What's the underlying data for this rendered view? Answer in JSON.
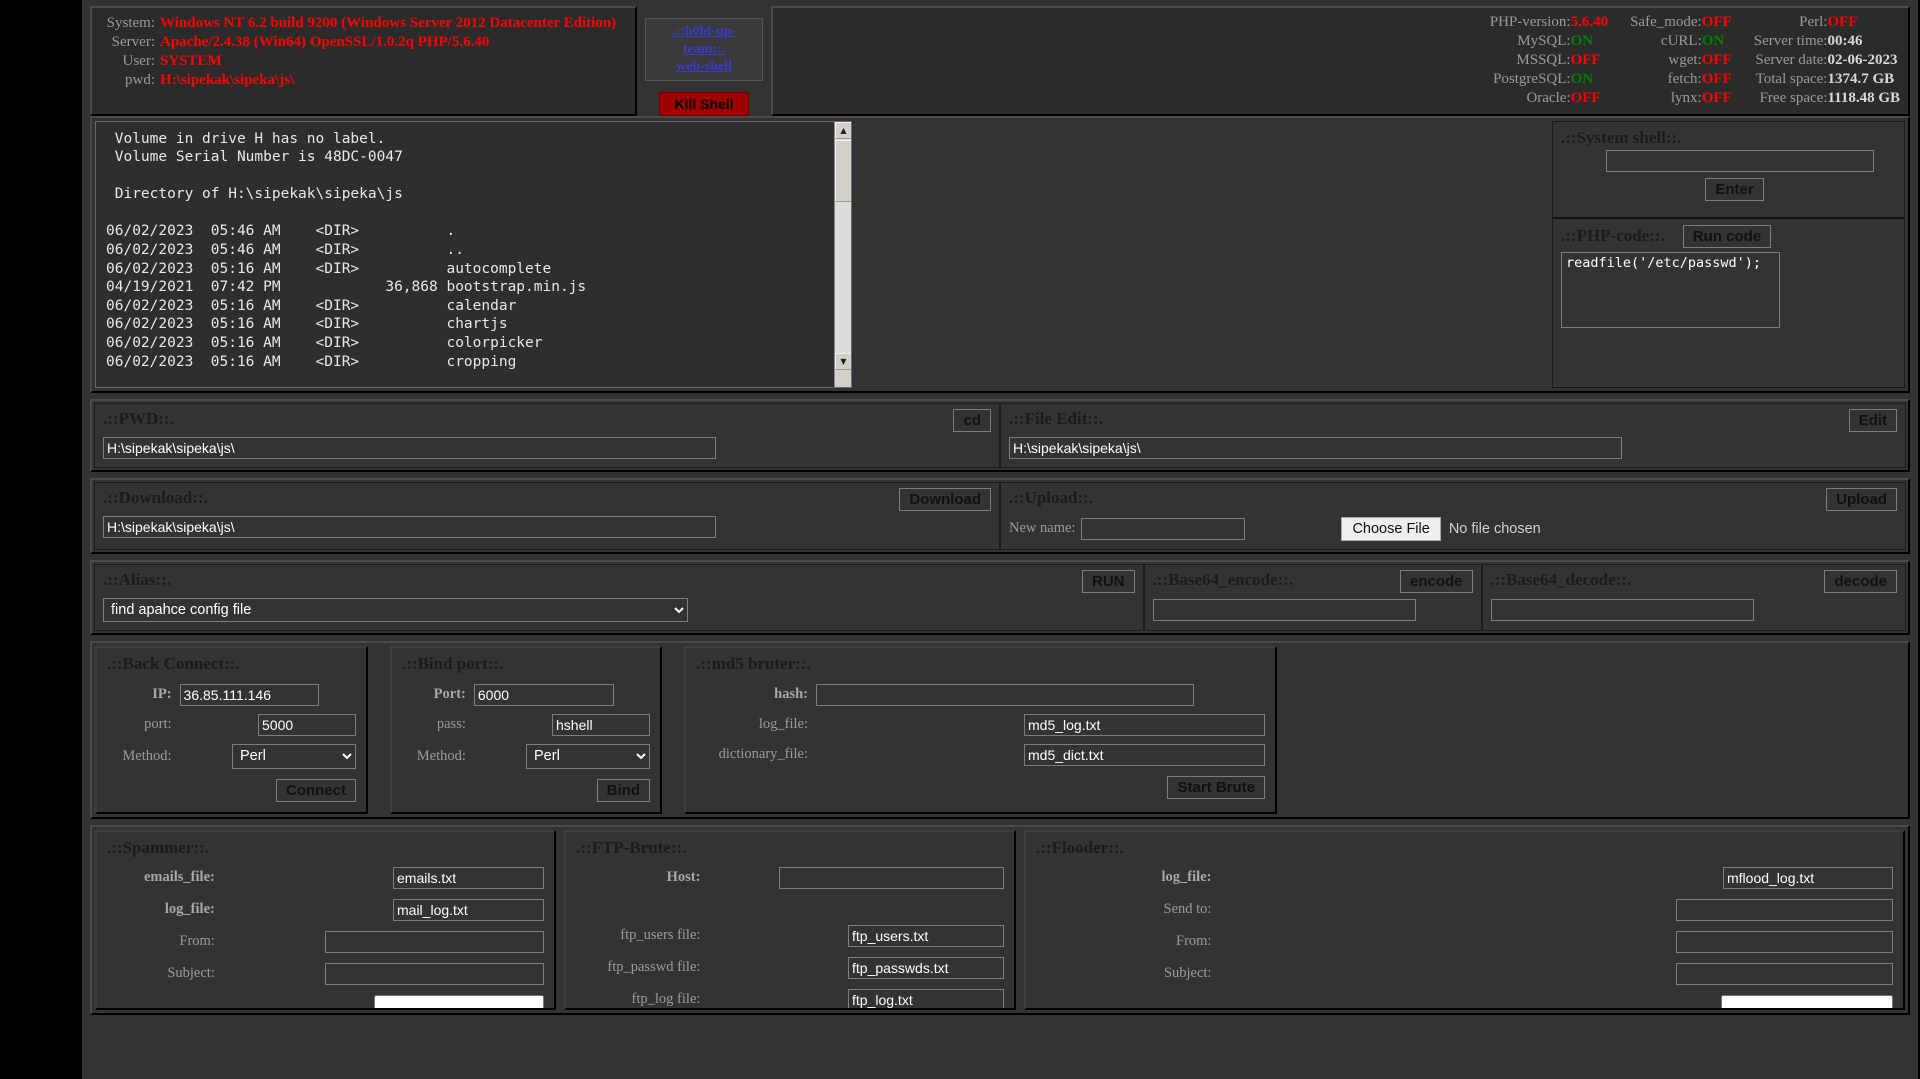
{
  "header": {
    "system_rows": [
      {
        "key": "System:",
        "value": "Windows NT 6.2 build 9200 (Windows Server 2012 Datacenter Edition)"
      },
      {
        "key": "Server:",
        "value": "Apache/2.4.38 (Win64) OpenSSL/1.0.2q PHP/5.6.40"
      },
      {
        "key": "User:",
        "value": "SYSTEM"
      },
      {
        "key": "pwd:",
        "value": "H:\\sipekak\\sipeka\\js\\"
      }
    ],
    "team_line1": ".::h0ld-up-team::.",
    "team_line2": "web-shell",
    "kill_shell": "Kill Shell",
    "info_col1": [
      {
        "key": "PHP-version:",
        "value": "5.6.40",
        "state": "red"
      },
      {
        "key": "MySQL:",
        "value": "ON",
        "state": "on"
      },
      {
        "key": "MSSQL:",
        "value": "OFF",
        "state": "off"
      },
      {
        "key": "PostgreSQL:",
        "value": "ON",
        "state": "on"
      },
      {
        "key": "Oracle:",
        "value": "OFF",
        "state": "off"
      }
    ],
    "info_col2": [
      {
        "key": "Safe_mode:",
        "value": "OFF",
        "state": "off"
      },
      {
        "key": "cURL:",
        "value": "ON",
        "state": "on"
      },
      {
        "key": "wget:",
        "value": "OFF",
        "state": "off"
      },
      {
        "key": "fetch:",
        "value": "OFF",
        "state": "off"
      },
      {
        "key": "lynx:",
        "value": "OFF",
        "state": "off"
      }
    ],
    "info_col3": [
      {
        "key": "Perl:",
        "value": "OFF",
        "state": "off"
      },
      {
        "key": "Server time:",
        "value": "00:46",
        "state": "white"
      },
      {
        "key": "Server date:",
        "value": "02-06-2023",
        "state": "white"
      },
      {
        "key": "Total space:",
        "value": "1374.7 GB",
        "state": "white"
      },
      {
        "key": "Free space:",
        "value": "1118.48 GB",
        "state": "white"
      }
    ]
  },
  "terminal": {
    "output": " Volume in drive H has no label.\n Volume Serial Number is 48DC-0047\n\n Directory of H:\\sipekak\\sipeka\\js\n\n06/02/2023  05:46 AM    <DIR>          .\n06/02/2023  05:46 AM    <DIR>          ..\n06/02/2023  05:16 AM    <DIR>          autocomplete\n04/19/2021  07:42 PM            36,868 bootstrap.min.js\n06/02/2023  05:16 AM    <DIR>          calendar\n06/02/2023  05:16 AM    <DIR>          chartjs\n06/02/2023  05:16 AM    <DIR>          colorpicker\n06/02/2023  05:16 AM    <DIR>          cropping"
  },
  "system_shell": {
    "title": ".::System shell::.",
    "command_value": "",
    "enter_label": "Enter"
  },
  "php_code": {
    "title": ".::PHP-code::.",
    "run_label": "Run code",
    "code": "readfile('/etc/passwd');"
  },
  "pwd": {
    "title": ".::PWD::.",
    "button": "cd",
    "value": "H:\\sipekak\\sipeka\\js\\"
  },
  "file_edit": {
    "title": ".::File Edit::.",
    "button": "Edit",
    "value": "H:\\sipekak\\sipeka\\js\\"
  },
  "download": {
    "title": ".::Download::.",
    "button": "Download",
    "value": "H:\\sipekak\\sipeka\\js\\"
  },
  "upload": {
    "title": ".::Upload::.",
    "button": "Upload",
    "newname_label": "New name:",
    "newname_value": "",
    "choose_file_label": "Choose File",
    "no_file_text": "No file chosen"
  },
  "alias": {
    "title": ".::Alias::.",
    "button": "RUN",
    "selected": "find apahce config file"
  },
  "base64_encode": {
    "title": ".::Base64_encode::.",
    "button": "encode",
    "value": ""
  },
  "base64_decode": {
    "title": ".::Base64_decode::.",
    "button": "decode",
    "value": ""
  },
  "back_connect": {
    "title": ".::Back Connect::.",
    "ip_label": "IP:",
    "ip_value": "36.85.111.146",
    "port_label": "port:",
    "port_value": "5000",
    "method_label": "Method:",
    "method_value": "Perl",
    "button": "Connect"
  },
  "bind_port": {
    "title": ".::Bind port::.",
    "port_label": "Port:",
    "port_value": "6000",
    "pass_label": "pass:",
    "pass_value": "hshell",
    "method_label": "Method:",
    "method_value": "Perl",
    "button": "Bind"
  },
  "md5_bruter": {
    "title": ".::md5 bruter::.",
    "hash_label": "hash:",
    "hash_value": "",
    "log_label": "log_file:",
    "log_value": "md5_log.txt",
    "dict_label": "dictionary_file:",
    "dict_value": "md5_dict.txt",
    "button": "Start Brute"
  },
  "spammer": {
    "title": ".::Spammer::.",
    "emails_label": "emails_file:",
    "emails_value": "emails.txt",
    "log_label": "log_file:",
    "log_value": "mail_log.txt",
    "from_label": "From:",
    "from_value": "",
    "subject_label": "Subject:",
    "subject_value": ""
  },
  "ftp_brute": {
    "title": ".::FTP-Brute::.",
    "host_label": "Host:",
    "host_value": "",
    "users_label": "ftp_users file:",
    "users_value": "ftp_users.txt",
    "passwd_label": "ftp_passwd file:",
    "passwd_value": "ftp_passwds.txt",
    "log_label": "ftp_log file:",
    "log_value": "ftp_log.txt"
  },
  "flooder": {
    "title": ".::Flooder::.",
    "log_label": "log_file:",
    "log_value": "mflood_log.txt",
    "sendto_label": "Send to:",
    "sendto_value": "",
    "from_label": "From:",
    "from_value": "",
    "subject_label": "Subject:",
    "subject_value": ""
  }
}
